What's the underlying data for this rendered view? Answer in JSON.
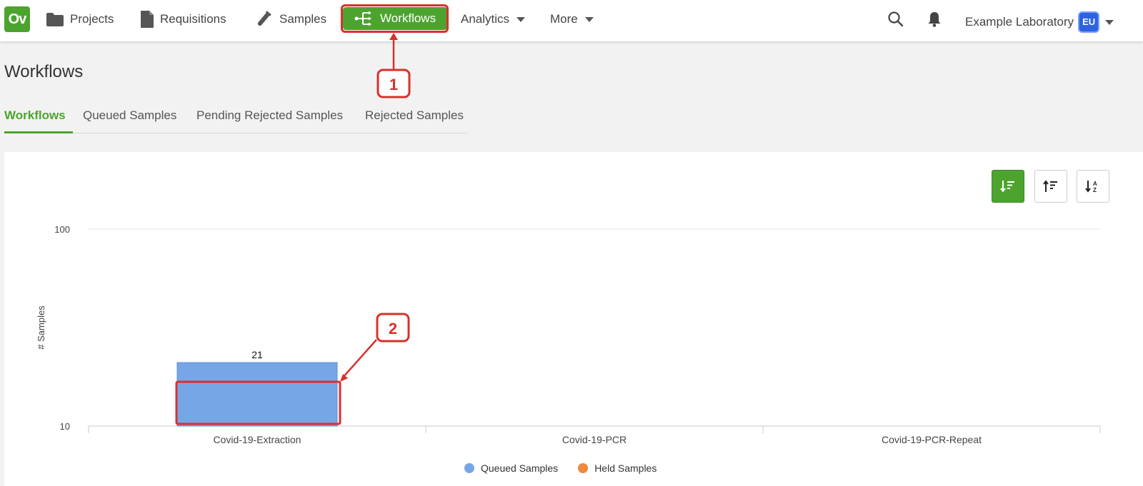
{
  "app": {
    "logo_text": "Ov"
  },
  "nav": {
    "items": [
      {
        "label": "Projects",
        "icon": "folder-icon"
      },
      {
        "label": "Requisitions",
        "icon": "document-icon"
      },
      {
        "label": "Samples",
        "icon": "test-tube-icon"
      },
      {
        "label": "Workflows",
        "icon": "workflow-icon",
        "active": true
      },
      {
        "label": "Analytics",
        "icon": "chevron-down-icon"
      },
      {
        "label": "More",
        "icon": "chevron-down-icon"
      }
    ],
    "lab_name": "Example Laboratory",
    "user_badge": "EU"
  },
  "page": {
    "title": "Workflows",
    "tabs": [
      {
        "label": "Workflows",
        "active": true
      },
      {
        "label": "Queued Samples"
      },
      {
        "label": "Pending Rejected Samples"
      },
      {
        "label": "Rejected Samples"
      }
    ]
  },
  "annotations": {
    "marker_1": "1",
    "marker_2": "2",
    "color": "#d8312b"
  },
  "colors": {
    "accent": "#4ca42f",
    "queued": "#76a6e6",
    "held": "#f0883d"
  },
  "chart_data": {
    "type": "bar",
    "yscale": "log",
    "ylim": [
      10,
      100
    ],
    "ylabel": "# Samples",
    "xlabel": "",
    "y_ticks": [
      "10",
      "100"
    ],
    "categories": [
      "Covid-19-Extraction",
      "Covid-19-PCR",
      "Covid-19-PCR-Repeat"
    ],
    "series": [
      {
        "name": "Queued Samples",
        "values": [
          21,
          null,
          null
        ],
        "color": "#76a6e6"
      },
      {
        "name": "Held Samples",
        "values": [
          null,
          null,
          null
        ],
        "color": "#f0883d"
      }
    ],
    "data_labels": [
      "21",
      "",
      ""
    ],
    "legend_position": "bottom",
    "grid": true
  }
}
